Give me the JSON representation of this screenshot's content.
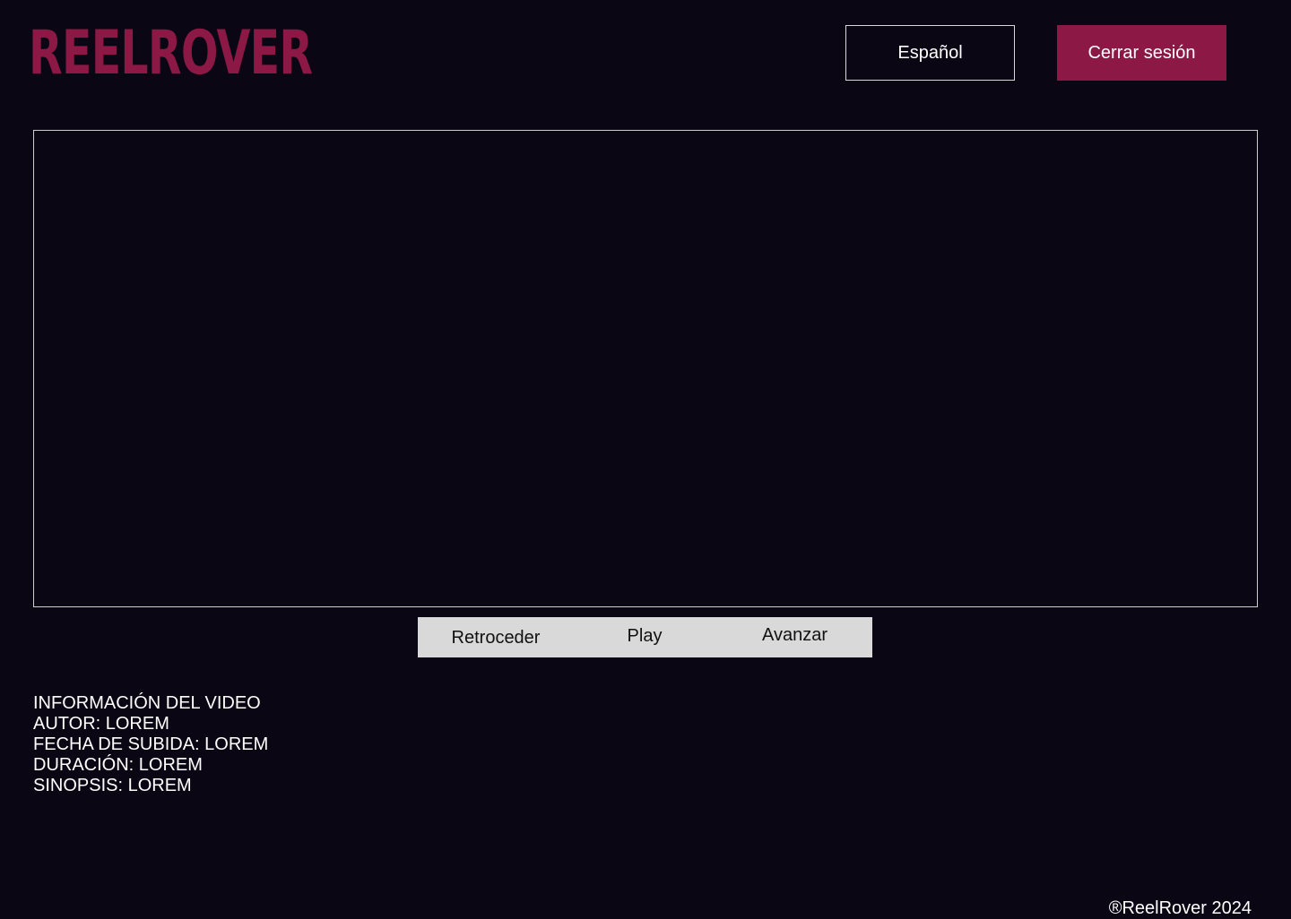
{
  "header": {
    "logo_text": "REELROVER",
    "language_button": "Español",
    "logout_button": "Cerrar sesión"
  },
  "player": {
    "rewind_label": "Retroceder",
    "play_label": "Play",
    "forward_label": "Avanzar"
  },
  "video_info": {
    "title": "INFORMACIÓN DEL VIDEO",
    "author": "AUTOR: LOREM",
    "upload_date": "FECHA DE SUBIDA: LOREM",
    "duration": "DURACIÓN: LOREM",
    "synopsis": "SINOPSIS: LOREM"
  },
  "footer": {
    "copyright": "®ReelRover 2024"
  },
  "colors": {
    "background": "#0a0613",
    "brand": "#8b1845",
    "controls_bg": "#d9d9d9"
  }
}
